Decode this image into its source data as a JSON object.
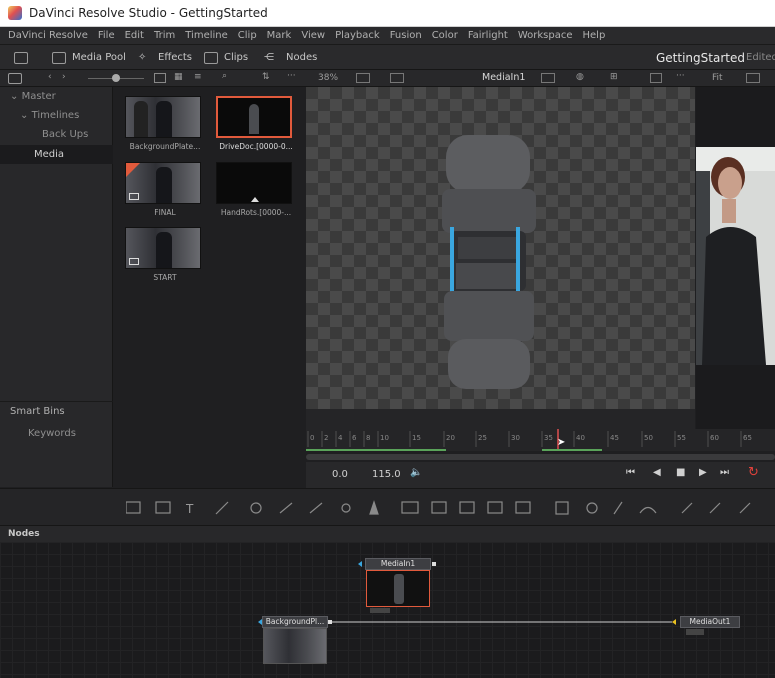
{
  "window": {
    "title": "DaVinci Resolve Studio - GettingStarted"
  },
  "menu": [
    "DaVinci Resolve",
    "File",
    "Edit",
    "Trim",
    "Timeline",
    "Clip",
    "Mark",
    "View",
    "Playback",
    "Fusion",
    "Color",
    "Fairlight",
    "Workspace",
    "Help"
  ],
  "toolbar": {
    "media_pool": "Media Pool",
    "effects": "Effects",
    "clips": "Clips",
    "nodes": "Nodes",
    "project": "GettingStarted",
    "status": "Edited"
  },
  "viewer_bar": {
    "zoom": "38%",
    "clip": "MediaIn1",
    "fit": "Fit"
  },
  "bins": {
    "master": "Master",
    "timelines": "Timelines",
    "backups": "Back Ups",
    "media": "Media",
    "smart_bins": "Smart Bins",
    "keywords": "Keywords"
  },
  "clips": [
    {
      "label": "BackgroundPlate..."
    },
    {
      "label": "DriveDoc.[0000-0..."
    },
    {
      "label": "FINAL"
    },
    {
      "label": "HandRots.[0000-..."
    },
    {
      "label": "START"
    }
  ],
  "ruler_ticks": [
    "0",
    "2",
    "4",
    "6",
    "8",
    "10",
    "15",
    "20",
    "25",
    "30",
    "35",
    "40",
    "45",
    "50",
    "55",
    "60",
    "65"
  ],
  "transport": {
    "start": "0.0",
    "end": "115.0"
  },
  "nodes_panel": {
    "title": "Nodes",
    "node1": "MediaIn1",
    "node2": "BackgroundPl...",
    "node3": "MediaOut1"
  },
  "colors": {
    "accent": "#e15a3c",
    "playhead": "#e05050",
    "loop": "#e0413b"
  }
}
